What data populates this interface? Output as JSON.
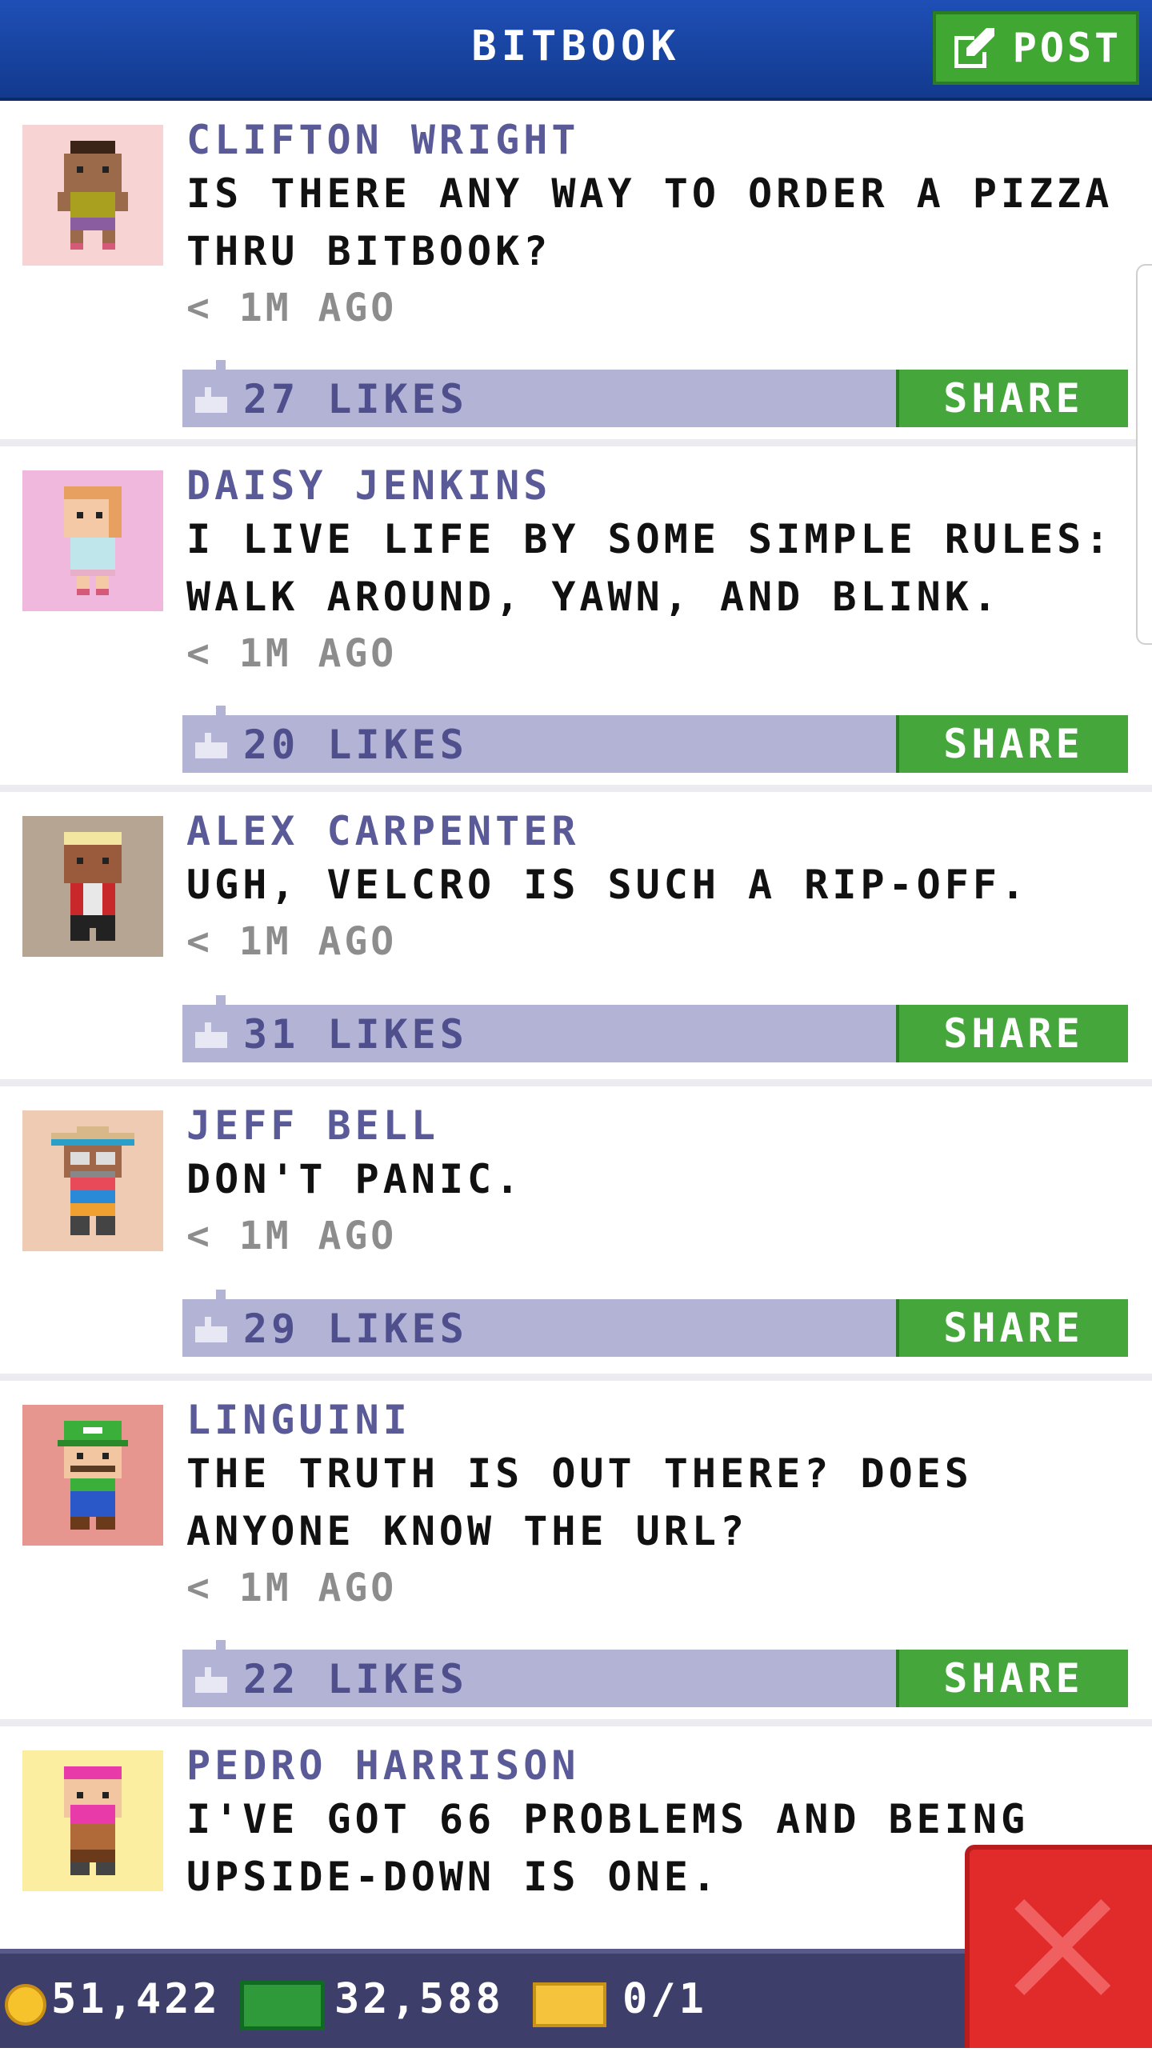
{
  "header": {
    "title": "BITBOOK",
    "post_label": "POST"
  },
  "posts": [
    {
      "name": "CLIFTON WRIGHT",
      "message": "IS THERE ANY WAY TO ORDER A PIZZA\nTHRU BITBOOK?",
      "time": "< 1M AGO",
      "likes": "27 LIKES",
      "share": "SHARE",
      "avatar_bg": "#f7d3d3"
    },
    {
      "name": "DAISY JENKINS",
      "message": "I LIVE LIFE BY SOME SIMPLE RULES:\nWALK AROUND, YAWN, AND BLINK.",
      "time": "< 1M AGO",
      "likes": "20 LIKES",
      "share": "SHARE",
      "avatar_bg": "#f0b8dc"
    },
    {
      "name": "ALEX CARPENTER",
      "message": "UGH, VELCRO IS SUCH A RIP-OFF.",
      "time": "< 1M AGO",
      "likes": "31 LIKES",
      "share": "SHARE",
      "avatar_bg": "#b7a593"
    },
    {
      "name": "JEFF BELL",
      "message": "DON'T PANIC.",
      "time": "< 1M AGO",
      "likes": "29 LIKES",
      "share": "SHARE",
      "avatar_bg": "#f0cbb3"
    },
    {
      "name": "LINGUINI",
      "message": "THE TRUTH IS OUT THERE? DOES\nANYONE KNOW THE URL?",
      "time": "< 1M AGO",
      "likes": "22 LIKES",
      "share": "SHARE",
      "avatar_bg": "#e6958f"
    },
    {
      "name": "PEDRO HARRISON",
      "message": "I'VE GOT 66 PROBLEMS AND BEING\nUPSIDE-DOWN IS ONE.",
      "time": "",
      "likes": "",
      "share": "",
      "avatar_bg": "#fbeea0"
    }
  ],
  "footer": {
    "coins": "51,422",
    "cash": "32,588",
    "tickets": "0/1"
  },
  "colors": {
    "header": "#1f4fb6",
    "share_green": "#44a63b",
    "like_bar": "#b3b3d6",
    "name": "#5a5a98",
    "close_red": "#e12a2a"
  },
  "icons": {
    "post": "edit-square-icon",
    "like": "thumbs-up-icon",
    "coin": "coin-icon",
    "cash": "cash-icon",
    "ticket": "ticket-icon",
    "close": "close-x-icon"
  }
}
